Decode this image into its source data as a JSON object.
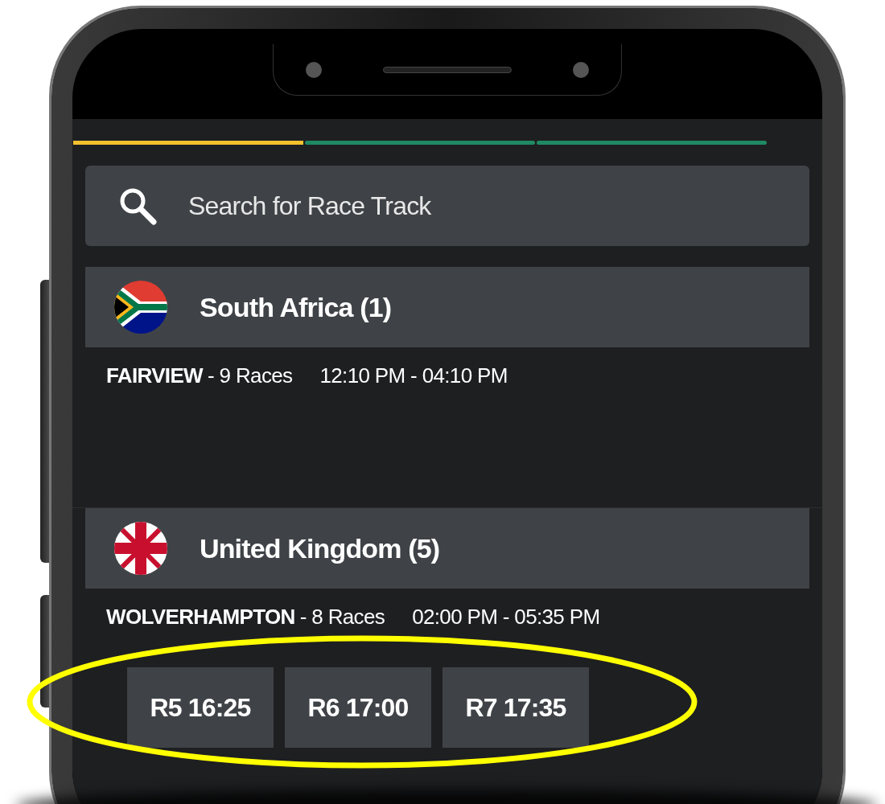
{
  "tabs": [
    {
      "selected": true
    },
    {
      "selected": false
    },
    {
      "selected": false
    }
  ],
  "search": {
    "placeholder": "Search for Race Track"
  },
  "countries": [
    {
      "name": "South Africa (1)",
      "kind": "za",
      "tracks": [
        {
          "name": "FAIRVIEW",
          "races": "- 9 Races",
          "time": "12:10 PM - 04:10 PM"
        }
      ]
    },
    {
      "name": "United Kingdom (5)",
      "kind": "gb",
      "tracks": [
        {
          "name": "WOLVERHAMPTON",
          "races": "- 8 Races",
          "time": "02:00 PM - 05:35 PM",
          "race_buttons": [
            "R5 16:25",
            "R6 17:00",
            "R7 17:35"
          ]
        }
      ]
    }
  ]
}
